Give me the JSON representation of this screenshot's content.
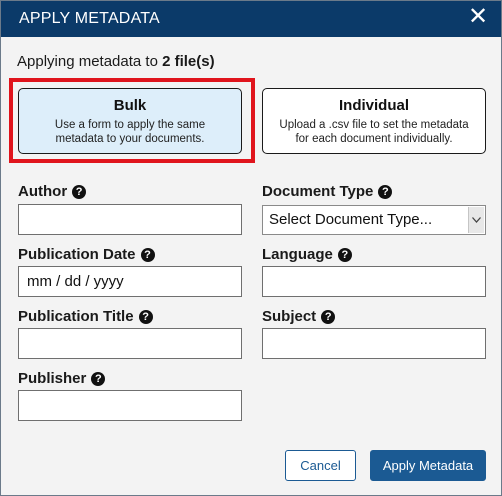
{
  "dialog": {
    "title": "APPLY METADATA",
    "close_icon": "close-icon"
  },
  "summary": {
    "prefix": "Applying metadata to ",
    "count_text": "2 file(s)"
  },
  "modes": {
    "bulk": {
      "title": "Bulk",
      "description": "Use a form to apply the same metadata to your documents."
    },
    "individual": {
      "title": "Individual",
      "description": "Upload a .csv file to set the metadata for each document individually."
    },
    "highlight_color": "#e0141c"
  },
  "fields": {
    "author": {
      "label": "Author",
      "value": ""
    },
    "document_type": {
      "label": "Document Type",
      "value": "Select Document Type..."
    },
    "publication_date": {
      "label": "Publication Date",
      "value": "mm / dd / yyyy"
    },
    "language": {
      "label": "Language",
      "value": ""
    },
    "publication_title": {
      "label": "Publication Title",
      "value": ""
    },
    "subject": {
      "label": "Subject",
      "value": ""
    },
    "publisher": {
      "label": "Publisher",
      "value": ""
    },
    "help_glyph": "?"
  },
  "footer": {
    "cancel_label": "Cancel",
    "apply_label": "Apply Metadata"
  },
  "colors": {
    "titlebar": "#0b3a69",
    "primary": "#1b5a93",
    "bulk_selected_bg": "#ddeefa"
  }
}
